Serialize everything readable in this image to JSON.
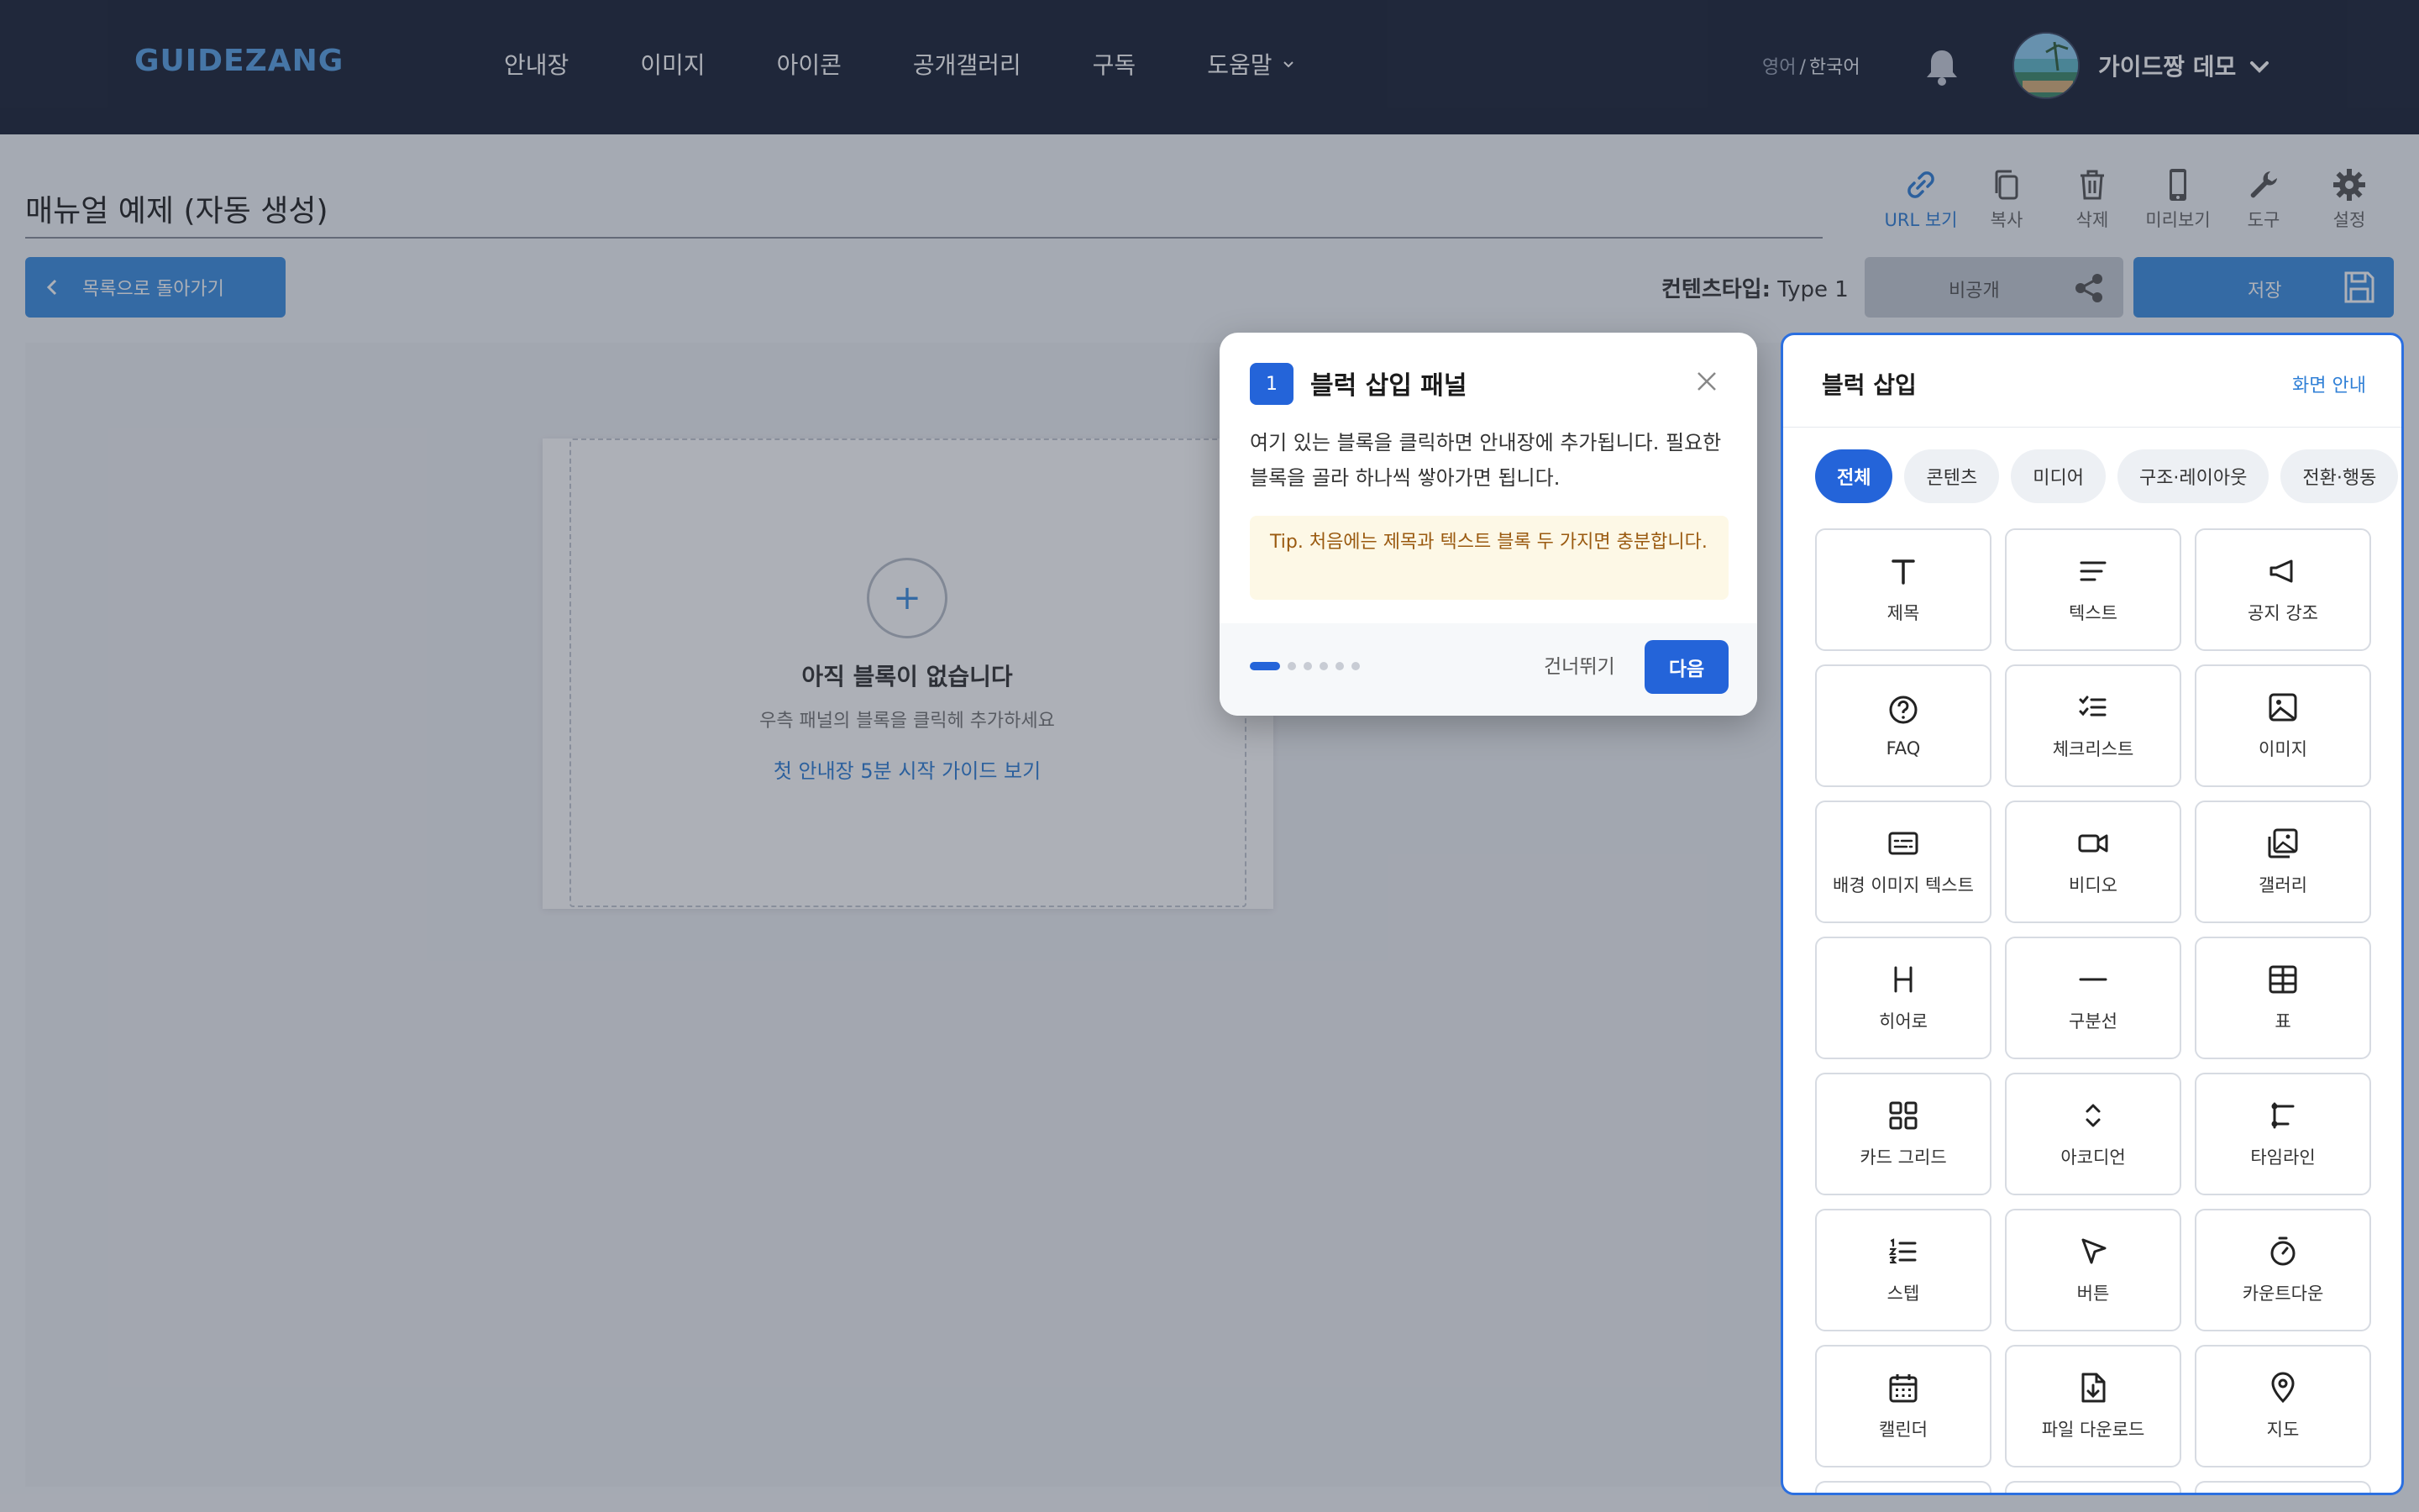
{
  "nav": {
    "brand": "GUIDEZANG",
    "items": [
      {
        "label": "안내장"
      },
      {
        "label": "이미지"
      },
      {
        "label": "아이콘"
      },
      {
        "label": "공개갤러리"
      },
      {
        "label": "구독"
      },
      {
        "label": "도움말"
      }
    ],
    "lang_inactive": "영어",
    "lang_sep": "/",
    "lang_active": "한국어",
    "username": "가이드짱 데모"
  },
  "editor": {
    "title": "매뉴얼 예제 (자동 생성)",
    "back_label": "목록으로 돌아가기",
    "content_type_label": "컨텐츠타입:",
    "content_type_value": "Type 1",
    "private_label": "비공개",
    "save_label": "저장",
    "toolbar": [
      {
        "label": "URL 보기",
        "icon": "link-icon"
      },
      {
        "label": "복사",
        "icon": "copy-icon"
      },
      {
        "label": "삭제",
        "icon": "trash-icon"
      },
      {
        "label": "미리보기",
        "icon": "phone-icon"
      },
      {
        "label": "도구",
        "icon": "wrench-icon"
      },
      {
        "label": "설정",
        "icon": "gear-icon"
      }
    ]
  },
  "canvas": {
    "plus": "+",
    "empty_title": "아직 블록이 없습니다",
    "empty_sub": "우측 패널의 블록을 클릭헤 추가하세요",
    "guide_link": "첫 안내장 5분 시작 가이드 보기"
  },
  "tour": {
    "step": "1",
    "title": "블럭 삽입 패널",
    "body": "여기 있는 블록을 클릭하면 안내장에 추가됩니다. 필요한 블록을 골라 하나씩 쌓아가면 됩니다.",
    "tip": "Tip. 처음에는 제목과 텍스트 블록 두 가지면 충분합니다.",
    "skip_label": "건너뛰기",
    "next_label": "다음",
    "total_steps": 6,
    "current_step": 1
  },
  "panel": {
    "title": "블럭 삽입",
    "guide": "화면 안내",
    "chips": [
      {
        "label": "전체"
      },
      {
        "label": "콘텐츠"
      },
      {
        "label": "미디어"
      },
      {
        "label": "구조·레이아웃"
      },
      {
        "label": "전환·행동"
      }
    ],
    "blocks": [
      {
        "label": "제목",
        "icon": "heading-icon"
      },
      {
        "label": "텍스트",
        "icon": "text-icon"
      },
      {
        "label": "공지 강조",
        "icon": "megaphone-icon"
      },
      {
        "label": "FAQ",
        "icon": "question-icon"
      },
      {
        "label": "체크리스트",
        "icon": "checklist-icon"
      },
      {
        "label": "이미지",
        "icon": "image-icon"
      },
      {
        "label": "배경 이미지 텍스트",
        "icon": "bg-text-icon"
      },
      {
        "label": "비디오",
        "icon": "video-icon"
      },
      {
        "label": "갤러리",
        "icon": "gallery-icon"
      },
      {
        "label": "히어로",
        "icon": "hero-icon"
      },
      {
        "label": "구분선",
        "icon": "divider-icon"
      },
      {
        "label": "표",
        "icon": "table-icon"
      },
      {
        "label": "카드 그리드",
        "icon": "grid-icon"
      },
      {
        "label": "아코디언",
        "icon": "accordion-icon"
      },
      {
        "label": "타임라인",
        "icon": "timeline-icon"
      },
      {
        "label": "스텝",
        "icon": "steps-icon"
      },
      {
        "label": "버튼",
        "icon": "cursor-icon"
      },
      {
        "label": "카운트다운",
        "icon": "timer-icon"
      },
      {
        "label": "캘린더",
        "icon": "calendar-icon"
      },
      {
        "label": "파일 다운로드",
        "icon": "file-download-icon"
      },
      {
        "label": "지도",
        "icon": "map-pin-icon"
      }
    ]
  },
  "colors": {
    "nav_bg": "#1b2336",
    "brand": "#5aa2e6",
    "accent": "#2464d9",
    "button_blue": "#3d8fe0",
    "tip_bg": "#fdf8e6",
    "tip_text": "#9a5a10"
  }
}
